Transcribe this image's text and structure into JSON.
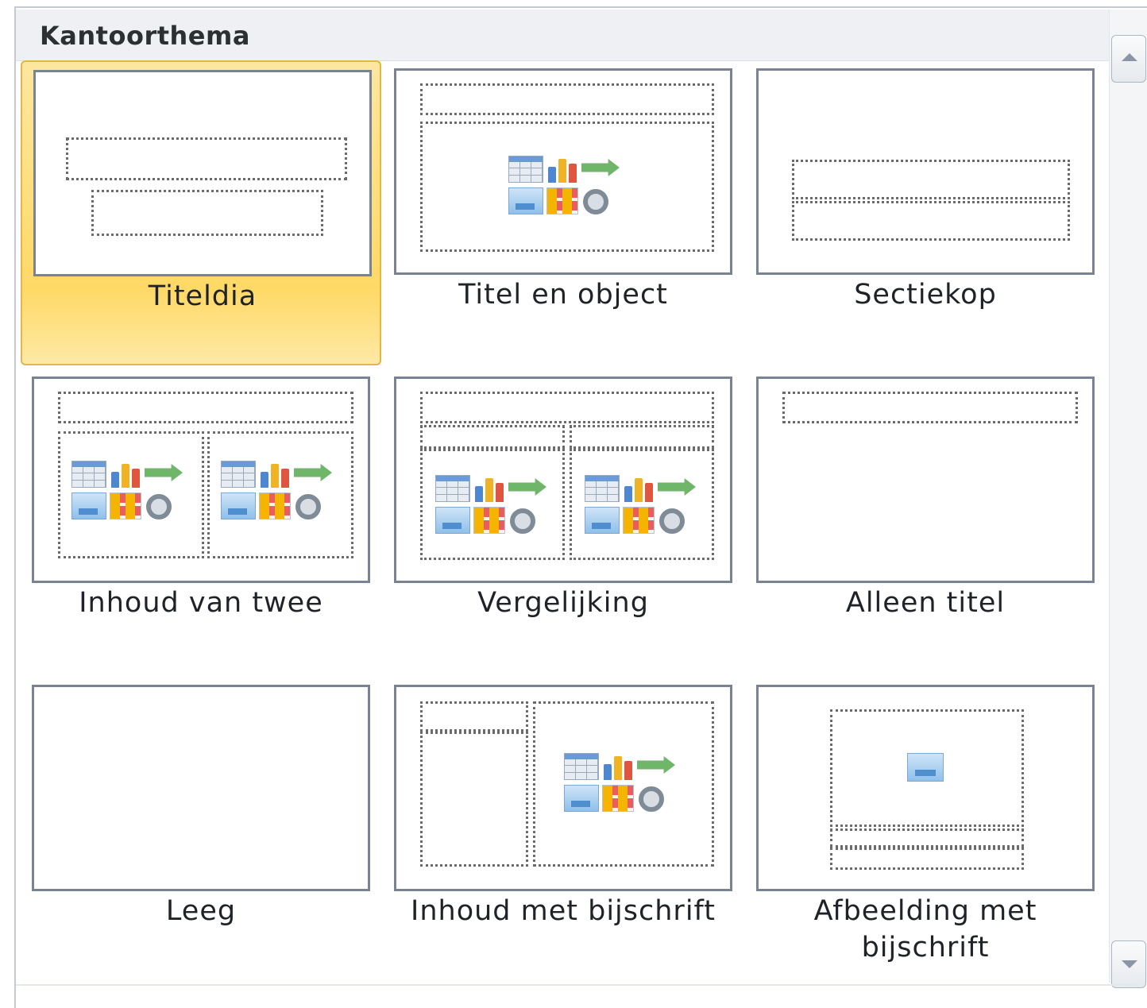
{
  "gallery": {
    "section_title": "Kantoorthema",
    "selected_layout": "Titeldia",
    "layouts": [
      {
        "id": "title-slide",
        "label": "Titeldia"
      },
      {
        "id": "title-and-content",
        "label": "Titel en object"
      },
      {
        "id": "section-header",
        "label": "Sectiekop"
      },
      {
        "id": "two-content",
        "label": "Inhoud van twee"
      },
      {
        "id": "comparison",
        "label": "Vergelijking"
      },
      {
        "id": "title-only",
        "label": "Alleen titel"
      },
      {
        "id": "blank",
        "label": "Leeg"
      },
      {
        "id": "content-with-caption",
        "label": "Inhoud met bijschrift"
      },
      {
        "id": "picture-with-caption",
        "label": "Afbeelding met bijschrift"
      }
    ]
  },
  "colors": {
    "selected_highlight": "#ffd966",
    "thumbnail_border": "#7a8394",
    "header_background": "#eef0f3"
  },
  "icons": {
    "content": "insert-content-icon",
    "picture": "picture-icon",
    "scroll_up": "scroll-up-arrow-icon",
    "scroll_down": "scroll-down-arrow-icon"
  }
}
